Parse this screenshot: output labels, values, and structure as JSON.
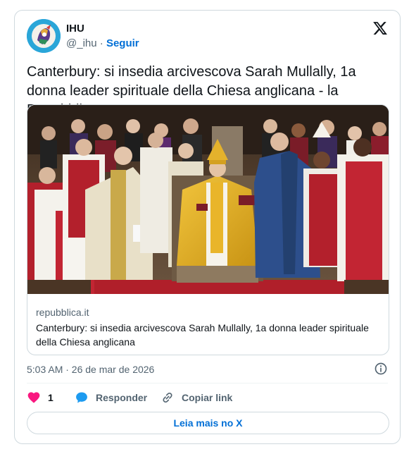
{
  "author": {
    "name": "IHU",
    "handle": "@_ihu",
    "separator": "·",
    "follow_label": "Seguir",
    "avatar_icon": "ihu-avatar-icon"
  },
  "brand_icon": "x-logo-icon",
  "tweet": {
    "text": "Canterbury: si insedia arcivescova Sarah Mullally, 1a donna leader spirituale della Chiesa anglicana - la Repubblica"
  },
  "link_card": {
    "image_icon": "ceremony-photo",
    "domain": "repubblica.it",
    "title": "Canterbury: si insedia arcivescova Sarah Mullally, 1a donna leader spirituale della Chiesa anglicana"
  },
  "timestamp": "5:03 AM · 26 de mar de 2026",
  "info_icon": "info-icon",
  "actions": {
    "like_count": "1",
    "reply_label": "Responder",
    "copy_label": "Copiar link"
  },
  "read_more_label": "Leia mais no X",
  "colors": {
    "accent": "#006fd6",
    "like": "#f91880",
    "reply": "#1d9bf0",
    "muted": "#536471",
    "border": "#cfd9de"
  }
}
